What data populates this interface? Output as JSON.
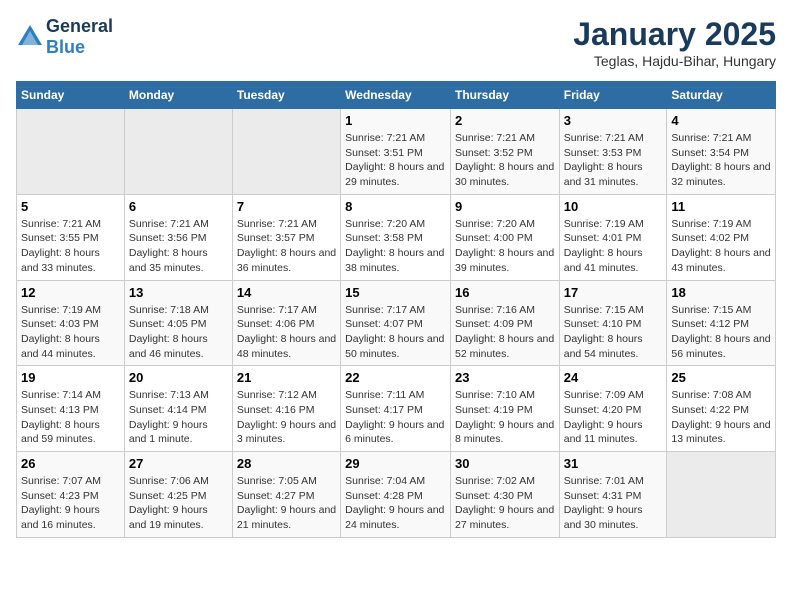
{
  "header": {
    "logo_general": "General",
    "logo_blue": "Blue",
    "month_year": "January 2025",
    "location": "Teglas, Hajdu-Bihar, Hungary"
  },
  "weekdays": [
    "Sunday",
    "Monday",
    "Tuesday",
    "Wednesday",
    "Thursday",
    "Friday",
    "Saturday"
  ],
  "weeks": [
    [
      {
        "day": "",
        "sunrise": "",
        "sunset": "",
        "daylight": ""
      },
      {
        "day": "",
        "sunrise": "",
        "sunset": "",
        "daylight": ""
      },
      {
        "day": "",
        "sunrise": "",
        "sunset": "",
        "daylight": ""
      },
      {
        "day": "1",
        "sunrise": "Sunrise: 7:21 AM",
        "sunset": "Sunset: 3:51 PM",
        "daylight": "Daylight: 8 hours and 29 minutes."
      },
      {
        "day": "2",
        "sunrise": "Sunrise: 7:21 AM",
        "sunset": "Sunset: 3:52 PM",
        "daylight": "Daylight: 8 hours and 30 minutes."
      },
      {
        "day": "3",
        "sunrise": "Sunrise: 7:21 AM",
        "sunset": "Sunset: 3:53 PM",
        "daylight": "Daylight: 8 hours and 31 minutes."
      },
      {
        "day": "4",
        "sunrise": "Sunrise: 7:21 AM",
        "sunset": "Sunset: 3:54 PM",
        "daylight": "Daylight: 8 hours and 32 minutes."
      }
    ],
    [
      {
        "day": "5",
        "sunrise": "Sunrise: 7:21 AM",
        "sunset": "Sunset: 3:55 PM",
        "daylight": "Daylight: 8 hours and 33 minutes."
      },
      {
        "day": "6",
        "sunrise": "Sunrise: 7:21 AM",
        "sunset": "Sunset: 3:56 PM",
        "daylight": "Daylight: 8 hours and 35 minutes."
      },
      {
        "day": "7",
        "sunrise": "Sunrise: 7:21 AM",
        "sunset": "Sunset: 3:57 PM",
        "daylight": "Daylight: 8 hours and 36 minutes."
      },
      {
        "day": "8",
        "sunrise": "Sunrise: 7:20 AM",
        "sunset": "Sunset: 3:58 PM",
        "daylight": "Daylight: 8 hours and 38 minutes."
      },
      {
        "day": "9",
        "sunrise": "Sunrise: 7:20 AM",
        "sunset": "Sunset: 4:00 PM",
        "daylight": "Daylight: 8 hours and 39 minutes."
      },
      {
        "day": "10",
        "sunrise": "Sunrise: 7:19 AM",
        "sunset": "Sunset: 4:01 PM",
        "daylight": "Daylight: 8 hours and 41 minutes."
      },
      {
        "day": "11",
        "sunrise": "Sunrise: 7:19 AM",
        "sunset": "Sunset: 4:02 PM",
        "daylight": "Daylight: 8 hours and 43 minutes."
      }
    ],
    [
      {
        "day": "12",
        "sunrise": "Sunrise: 7:19 AM",
        "sunset": "Sunset: 4:03 PM",
        "daylight": "Daylight: 8 hours and 44 minutes."
      },
      {
        "day": "13",
        "sunrise": "Sunrise: 7:18 AM",
        "sunset": "Sunset: 4:05 PM",
        "daylight": "Daylight: 8 hours and 46 minutes."
      },
      {
        "day": "14",
        "sunrise": "Sunrise: 7:17 AM",
        "sunset": "Sunset: 4:06 PM",
        "daylight": "Daylight: 8 hours and 48 minutes."
      },
      {
        "day": "15",
        "sunrise": "Sunrise: 7:17 AM",
        "sunset": "Sunset: 4:07 PM",
        "daylight": "Daylight: 8 hours and 50 minutes."
      },
      {
        "day": "16",
        "sunrise": "Sunrise: 7:16 AM",
        "sunset": "Sunset: 4:09 PM",
        "daylight": "Daylight: 8 hours and 52 minutes."
      },
      {
        "day": "17",
        "sunrise": "Sunrise: 7:15 AM",
        "sunset": "Sunset: 4:10 PM",
        "daylight": "Daylight: 8 hours and 54 minutes."
      },
      {
        "day": "18",
        "sunrise": "Sunrise: 7:15 AM",
        "sunset": "Sunset: 4:12 PM",
        "daylight": "Daylight: 8 hours and 56 minutes."
      }
    ],
    [
      {
        "day": "19",
        "sunrise": "Sunrise: 7:14 AM",
        "sunset": "Sunset: 4:13 PM",
        "daylight": "Daylight: 8 hours and 59 minutes."
      },
      {
        "day": "20",
        "sunrise": "Sunrise: 7:13 AM",
        "sunset": "Sunset: 4:14 PM",
        "daylight": "Daylight: 9 hours and 1 minute."
      },
      {
        "day": "21",
        "sunrise": "Sunrise: 7:12 AM",
        "sunset": "Sunset: 4:16 PM",
        "daylight": "Daylight: 9 hours and 3 minutes."
      },
      {
        "day": "22",
        "sunrise": "Sunrise: 7:11 AM",
        "sunset": "Sunset: 4:17 PM",
        "daylight": "Daylight: 9 hours and 6 minutes."
      },
      {
        "day": "23",
        "sunrise": "Sunrise: 7:10 AM",
        "sunset": "Sunset: 4:19 PM",
        "daylight": "Daylight: 9 hours and 8 minutes."
      },
      {
        "day": "24",
        "sunrise": "Sunrise: 7:09 AM",
        "sunset": "Sunset: 4:20 PM",
        "daylight": "Daylight: 9 hours and 11 minutes."
      },
      {
        "day": "25",
        "sunrise": "Sunrise: 7:08 AM",
        "sunset": "Sunset: 4:22 PM",
        "daylight": "Daylight: 9 hours and 13 minutes."
      }
    ],
    [
      {
        "day": "26",
        "sunrise": "Sunrise: 7:07 AM",
        "sunset": "Sunset: 4:23 PM",
        "daylight": "Daylight: 9 hours and 16 minutes."
      },
      {
        "day": "27",
        "sunrise": "Sunrise: 7:06 AM",
        "sunset": "Sunset: 4:25 PM",
        "daylight": "Daylight: 9 hours and 19 minutes."
      },
      {
        "day": "28",
        "sunrise": "Sunrise: 7:05 AM",
        "sunset": "Sunset: 4:27 PM",
        "daylight": "Daylight: 9 hours and 21 minutes."
      },
      {
        "day": "29",
        "sunrise": "Sunrise: 7:04 AM",
        "sunset": "Sunset: 4:28 PM",
        "daylight": "Daylight: 9 hours and 24 minutes."
      },
      {
        "day": "30",
        "sunrise": "Sunrise: 7:02 AM",
        "sunset": "Sunset: 4:30 PM",
        "daylight": "Daylight: 9 hours and 27 minutes."
      },
      {
        "day": "31",
        "sunrise": "Sunrise: 7:01 AM",
        "sunset": "Sunset: 4:31 PM",
        "daylight": "Daylight: 9 hours and 30 minutes."
      },
      {
        "day": "",
        "sunrise": "",
        "sunset": "",
        "daylight": ""
      }
    ]
  ]
}
